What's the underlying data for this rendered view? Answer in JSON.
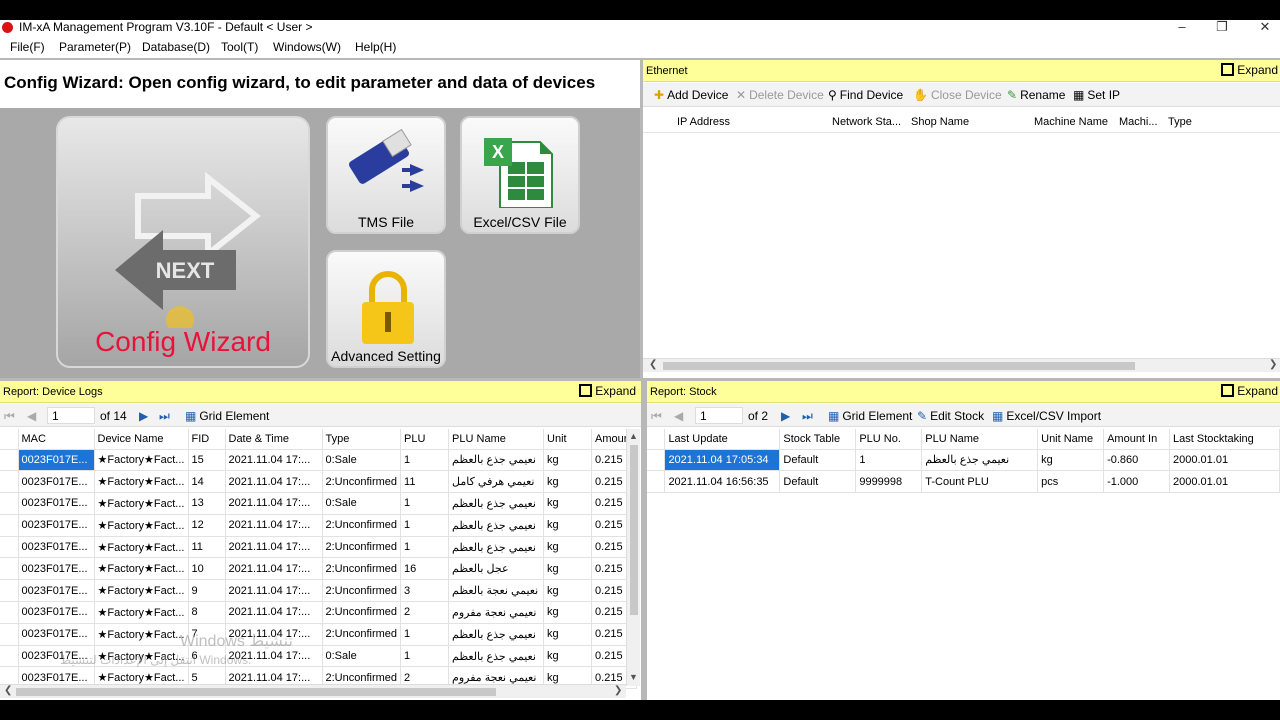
{
  "window": {
    "title": "IM-xA Management Program V3.10F - Default < User >",
    "min_glyph": "–",
    "max_glyph": "❐",
    "close_glyph": "✕"
  },
  "menu": [
    "File(F)",
    "Parameter(P)",
    "Database(D)",
    "Tool(T)",
    "Windows(W)",
    "Help(H)"
  ],
  "wizard": {
    "heading": "Config Wizard: Open config wizard, to edit parameter and data of devices",
    "next_label": "NEXT",
    "config_label": "Config Wizard",
    "tms_label": "TMS File",
    "excel_label": "Excel/CSV File",
    "advanced_label": "Advanced Setting"
  },
  "ethernet": {
    "title": "Ethernet",
    "expand": "Expand",
    "toolbar": {
      "add": "Add Device",
      "delete": "Delete Device",
      "find": "Find Device",
      "close": "Close Device",
      "rename": "Rename",
      "setip": "Set IP"
    },
    "columns": [
      "IP Address",
      "Network Sta...",
      "Shop Name",
      "Machine Name",
      "Machi...",
      "Type"
    ]
  },
  "logs": {
    "title": "Report: Device Logs",
    "expand": "Expand",
    "page": "1",
    "of_pages": "of 14",
    "grid_element": "Grid Element",
    "columns": [
      "MAC",
      "Device Name",
      "FID",
      "Date & Time",
      "Type",
      "PLU",
      "PLU Name",
      "Unit",
      "Amount"
    ],
    "rows": [
      [
        "0023F017E...",
        "★Factory★Fact...",
        "15",
        "2021.11.04 17:...",
        "0:Sale",
        "1",
        "نعيمي جذع بالعظم",
        "kg",
        "0.215"
      ],
      [
        "0023F017E...",
        "★Factory★Fact...",
        "14",
        "2021.11.04 17:...",
        "2:Unconfirmed",
        "11",
        "نعيمي هرفي كامل",
        "kg",
        "0.215"
      ],
      [
        "0023F017E...",
        "★Factory★Fact...",
        "13",
        "2021.11.04 17:...",
        "0:Sale",
        "1",
        "نعيمي جذع بالعظم",
        "kg",
        "0.215"
      ],
      [
        "0023F017E...",
        "★Factory★Fact...",
        "12",
        "2021.11.04 17:...",
        "2:Unconfirmed",
        "1",
        "نعيمي جذع بالعظم",
        "kg",
        "0.215"
      ],
      [
        "0023F017E...",
        "★Factory★Fact...",
        "11",
        "2021.11.04 17:...",
        "2:Unconfirmed",
        "1",
        "نعيمي جذع بالعظم",
        "kg",
        "0.215"
      ],
      [
        "0023F017E...",
        "★Factory★Fact...",
        "10",
        "2021.11.04 17:...",
        "2:Unconfirmed",
        "16",
        "عجل بالعظم",
        "kg",
        "0.215"
      ],
      [
        "0023F017E...",
        "★Factory★Fact...",
        "9",
        "2021.11.04 17:...",
        "2:Unconfirmed",
        "3",
        "نعيمي نعجة بالعظم",
        "kg",
        "0.215"
      ],
      [
        "0023F017E...",
        "★Factory★Fact...",
        "8",
        "2021.11.04 17:...",
        "2:Unconfirmed",
        "2",
        "نعيمي نعجة مفروم",
        "kg",
        "0.215"
      ],
      [
        "0023F017E...",
        "★Factory★Fact...",
        "7",
        "2021.11.04 17:...",
        "2:Unconfirmed",
        "1",
        "نعيمي جذع بالعظم",
        "kg",
        "0.215"
      ],
      [
        "0023F017E...",
        "★Factory★Fact...",
        "6",
        "2021.11.04 17:...",
        "0:Sale",
        "1",
        "نعيمي جذع بالعظم",
        "kg",
        "0.215"
      ],
      [
        "0023F017E...",
        "★Factory★Fact...",
        "5",
        "2021.11.04 17:...",
        "2:Unconfirmed",
        "2",
        "نعيمي نعجة مفروم",
        "kg",
        "0.215"
      ]
    ]
  },
  "stock": {
    "title": "Report: Stock",
    "expand": "Expand",
    "page": "1",
    "of_pages": "of 2",
    "grid_element": "Grid Element",
    "edit_stock": "Edit Stock",
    "import": "Excel/CSV Import",
    "columns": [
      "Last Update",
      "Stock Table",
      "PLU No.",
      "PLU Name",
      "Unit Name",
      "Amount In",
      "Last Stocktaking"
    ],
    "rows": [
      [
        "2021.11.04 17:05:34",
        "Default",
        "1",
        "نعيمي جذع بالعظم",
        "kg",
        "-0.860",
        "2000.01.01"
      ],
      [
        "2021.11.04 16:56:35",
        "Default",
        "9999998",
        "T-Count PLU",
        "pcs",
        "-1.000",
        "2000.01.01"
      ]
    ]
  },
  "watermark": {
    "line1": "Windows تنشيط",
    "line2": "انتقل إلى الإعدادات لتنشيط Windows."
  },
  "colors": {
    "panel_header": "#ffff99",
    "selection": "#1e74d4",
    "config_text": "#e8133b"
  }
}
